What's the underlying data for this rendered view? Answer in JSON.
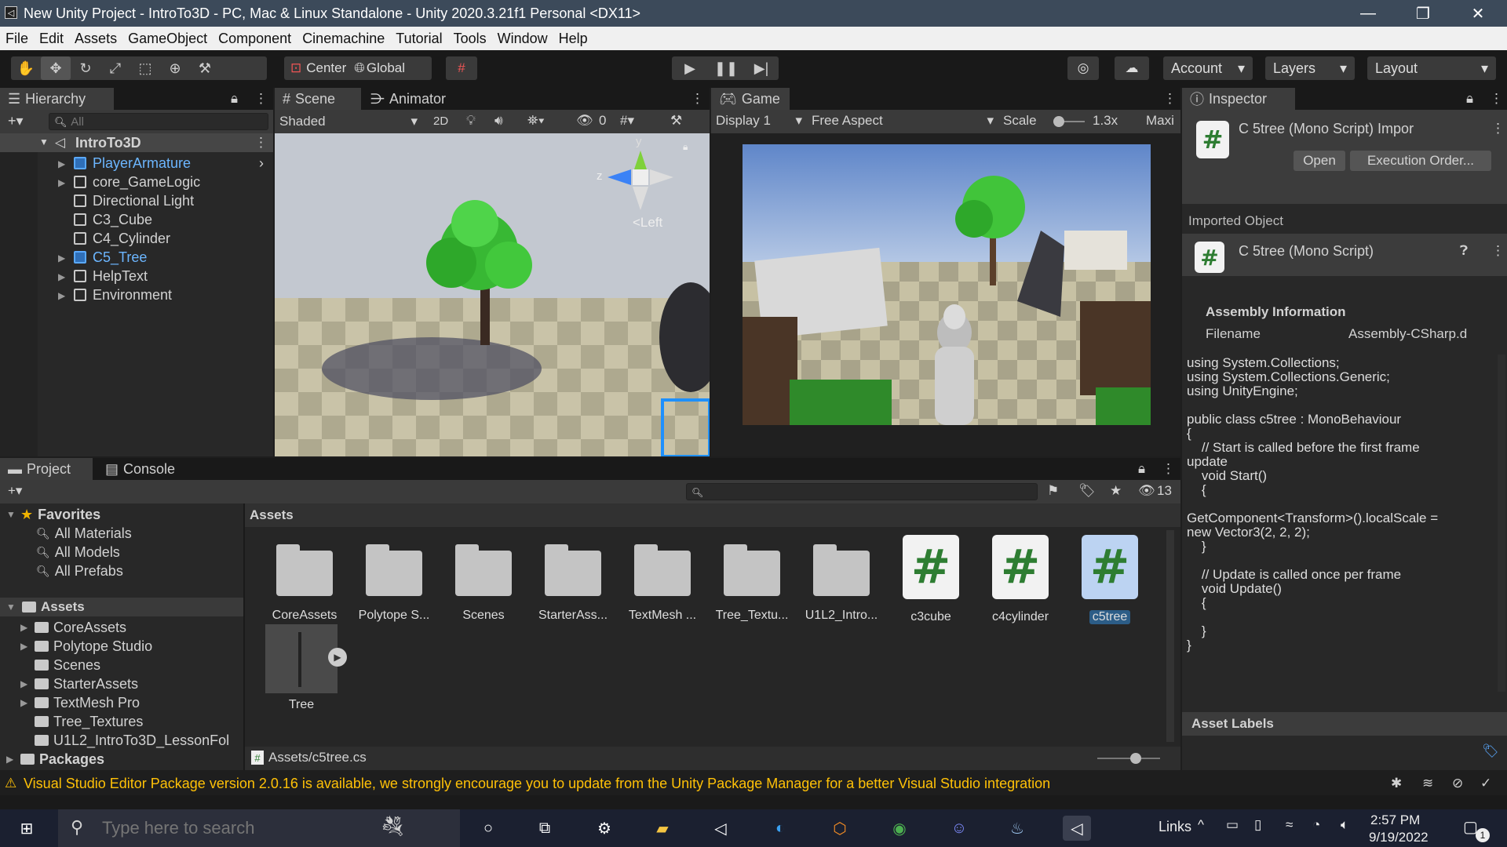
{
  "titlebar": {
    "title": "New Unity Project - IntroTo3D - PC, Mac & Linux Standalone - Unity 2020.3.21f1 Personal <DX11>",
    "minimize": "—",
    "maximize": "❐",
    "close": "✕"
  },
  "menu": [
    "File",
    "Edit",
    "Assets",
    "GameObject",
    "Component",
    "Cinemachine",
    "Tutorial",
    "Tools",
    "Window",
    "Help"
  ],
  "toolbar": {
    "pivot": "Center",
    "space": "Global",
    "account": "Account",
    "layers": "Layers",
    "layout": "Layout"
  },
  "hierarchy": {
    "tab": "Hierarchy",
    "search_placeholder": "All",
    "scene": "IntroTo3D",
    "items": [
      {
        "label": "PlayerArmature",
        "highlight": true,
        "expandable": true
      },
      {
        "label": "core_GameLogic",
        "highlight": false,
        "expandable": true
      },
      {
        "label": "Directional Light",
        "highlight": false,
        "expandable": false
      },
      {
        "label": "C3_Cube",
        "highlight": false,
        "expandable": false
      },
      {
        "label": "C4_Cylinder",
        "highlight": false,
        "expandable": false
      },
      {
        "label": "C5_Tree",
        "highlight": true,
        "expandable": true
      },
      {
        "label": "HelpText",
        "highlight": false,
        "expandable": true
      },
      {
        "label": "Environment",
        "highlight": false,
        "expandable": true
      }
    ]
  },
  "scene": {
    "tab": "Scene",
    "tab2": "Animator",
    "shading": "Shaded",
    "mode2d": "2D",
    "hidden_count": "0",
    "gizmo_y": "y",
    "gizmo_z": "z",
    "view_label": "<Left"
  },
  "game": {
    "tab": "Game",
    "display": "Display 1",
    "aspect": "Free Aspect",
    "scale_label": "Scale",
    "scale_value": "1.3x",
    "maximize": "Maxi"
  },
  "inspector": {
    "tab": "Inspector",
    "title": "C 5tree (Mono Script) Impor",
    "open": "Open",
    "exec_order": "Execution Order...",
    "imported_object": "Imported Object",
    "script_title": "C 5tree (Mono Script)",
    "assembly_info": "Assembly Information",
    "filename_label": "Filename",
    "filename_value": "Assembly-CSharp.d",
    "code": "using System.Collections;\nusing System.Collections.Generic;\nusing UnityEngine;\n\npublic class c5tree : MonoBehaviour\n{\n    // Start is called before the first frame\nupdate\n    void Start()\n    {\n\nGetComponent<Transform>().localScale =\nnew Vector3(2, 2, 2);\n    }\n\n    // Update is called once per frame\n    void Update()\n    {\n\n    }\n}",
    "asset_labels": "Asset Labels"
  },
  "project": {
    "tab": "Project",
    "tab2": "Console",
    "hidden_count": "13",
    "favorites": "Favorites",
    "fav_items": [
      "All Materials",
      "All Models",
      "All Prefabs"
    ],
    "assets_root": "Assets",
    "asset_folders": [
      "CoreAssets",
      "Polytope Studio",
      "Scenes",
      "StarterAssets",
      "TextMesh Pro",
      "Tree_Textures",
      "U1L2_IntroTo3D_LessonFol"
    ],
    "packages": "Packages",
    "breadcrumb": "Assets",
    "grid_items": [
      {
        "label": "CoreAssets",
        "kind": "folder"
      },
      {
        "label": "Polytope S...",
        "kind": "folder"
      },
      {
        "label": "Scenes",
        "kind": "folder"
      },
      {
        "label": "StarterAss...",
        "kind": "folder"
      },
      {
        "label": "TextMesh ...",
        "kind": "folder"
      },
      {
        "label": "Tree_Textu...",
        "kind": "folder"
      },
      {
        "label": "U1L2_Intro...",
        "kind": "folder"
      },
      {
        "label": "c3cube",
        "kind": "script"
      },
      {
        "label": "c4cylinder",
        "kind": "script"
      },
      {
        "label": "c5tree",
        "kind": "script-selected"
      }
    ],
    "tree_label": "Tree",
    "footer_path": "Assets/c5tree.cs"
  },
  "status": {
    "message": "Visual Studio Editor Package version 2.0.16 is available, we strongly encourage you to update from the Unity Package Manager for a better Visual Studio integration"
  },
  "taskbar": {
    "search_placeholder": "Type here to search",
    "links": "Links",
    "time": "2:57 PM",
    "date": "9/19/2022",
    "notif_count": "1"
  },
  "colors": {
    "title_bg": "#3c4a5a",
    "accent_blue": "#5aa9ff",
    "warning": "#ffc107"
  }
}
